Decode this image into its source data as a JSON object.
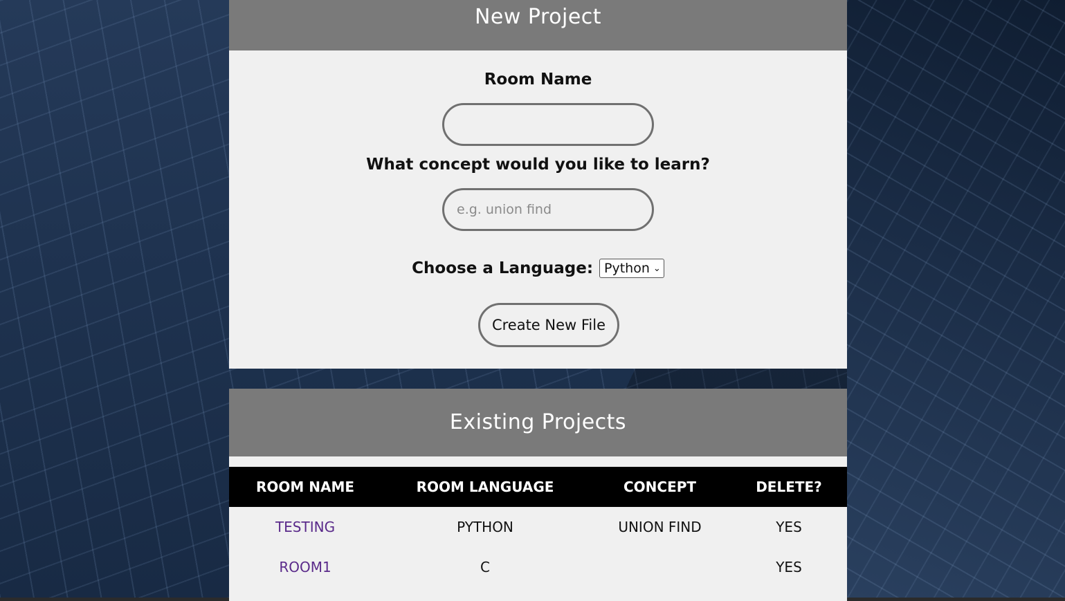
{
  "new_project": {
    "title": "New Project",
    "room_name_label": "Room Name",
    "room_name_value": "",
    "concept_label": "What concept would you like to learn?",
    "concept_placeholder": "e.g. union find",
    "language_label": "Choose a Language:",
    "language_selected": "Python",
    "create_button": "Create New File"
  },
  "existing_projects": {
    "title": "Existing Projects",
    "columns": [
      "ROOM NAME",
      "ROOM LANGUAGE",
      "CONCEPT",
      "DELETE?"
    ],
    "rows": [
      {
        "room_name": "TESTING",
        "language": "PYTHON",
        "concept": "UNION FIND",
        "delete": "YES"
      },
      {
        "room_name": "ROOM1",
        "language": "C",
        "concept": "",
        "delete": "YES"
      }
    ]
  },
  "colors": {
    "header_bg": "#7a7a7a",
    "panel_bg": "#f0f0f0",
    "table_header_bg": "#000000",
    "link": "#5a2a8a"
  }
}
